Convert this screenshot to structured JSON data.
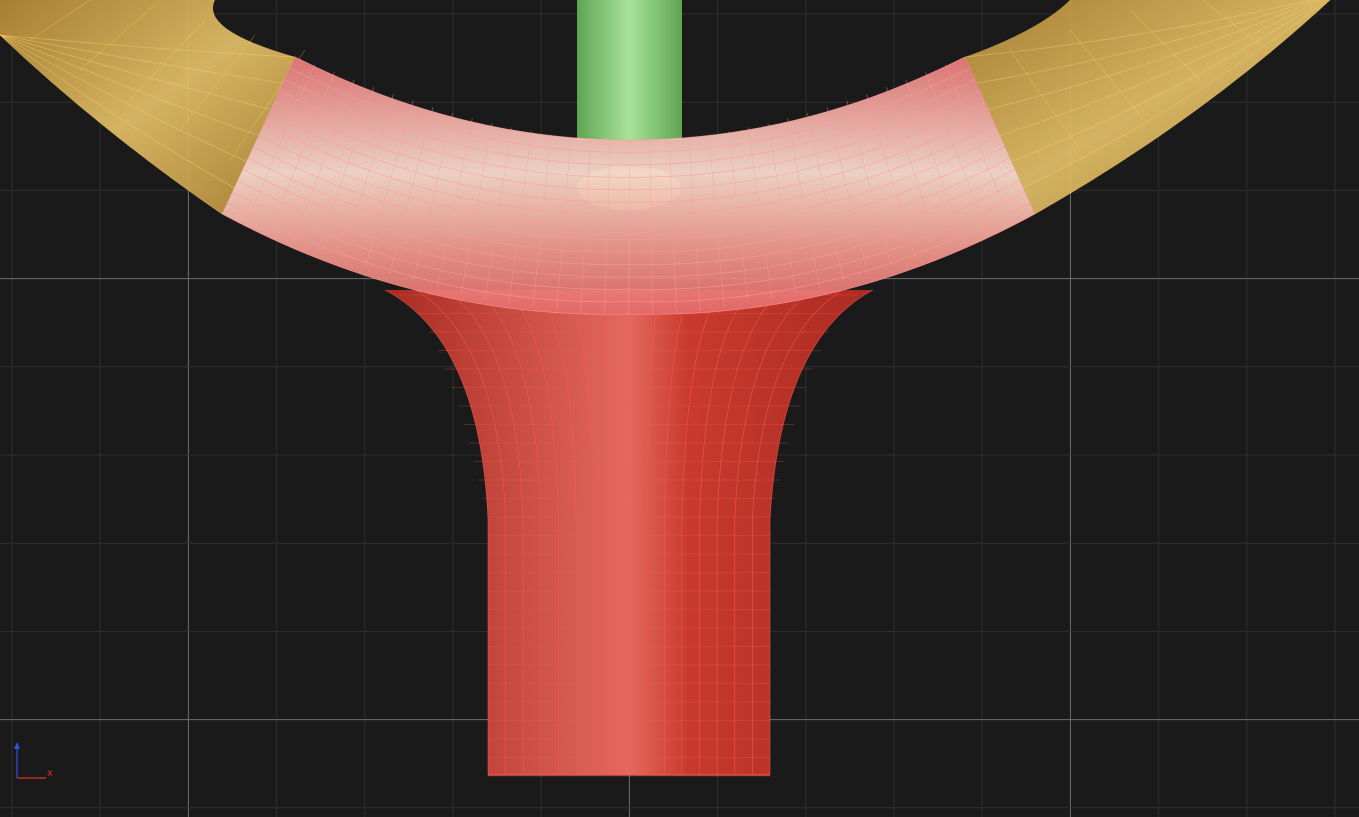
{
  "viewport": {
    "background": "#1a1a1a",
    "grid_minor_color": "#2f2f2f",
    "grid_major_color": "#6e6e6e"
  },
  "scene": {
    "ring": {
      "color_yellow": "#e7b955",
      "color_highlight": "#f1e39a",
      "wire_color": "#ffcf6a"
    },
    "selected_bend": {
      "color_pink": "#f48b8b",
      "color_highlight": "#fde3d6",
      "wire_color": "#ff9a9a"
    },
    "stem_green": {
      "color": "#6db55f",
      "color_highlight": "#a8e39a"
    },
    "selected_flare": {
      "color_red": "#c93a2e",
      "color_highlight": "#e3695e",
      "wire_color": "#ff5a4a"
    }
  },
  "axis_gizmo": {
    "x_label": "x",
    "x_color": "#e03030",
    "z_color": "#3050e0"
  }
}
